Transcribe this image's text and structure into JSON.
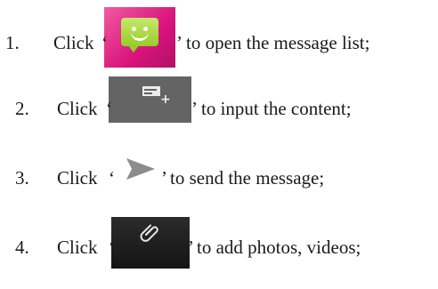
{
  "steps": [
    {
      "number": "1.",
      "click_text": "Click",
      "open_quote": "‘",
      "close_quote": "’",
      "rest": "to open the message list;",
      "icon": "messaging-app-icon",
      "icon_colors": {
        "background": "#d8147c",
        "bubble": "#97cc2c"
      }
    },
    {
      "number": "2.",
      "click_text": "Click",
      "open_quote": "‘",
      "close_quote": "’",
      "rest": "to input the content;",
      "icon": "new-message-icon",
      "icon_colors": {
        "background": "#646464",
        "glyph": "#ececec"
      }
    },
    {
      "number": "3.",
      "click_text": "Click",
      "open_quote": "‘",
      "close_quote": "’",
      "rest": "to send the message;",
      "icon": "send-arrow-icon",
      "icon_colors": {
        "glyph": "#8c8c8c"
      }
    },
    {
      "number": "4.",
      "click_text": "Click",
      "open_quote": "‘",
      "close_quote": "’",
      "rest": "to add photos, videos;",
      "icon": "paperclip-attach-icon",
      "icon_colors": {
        "background": "#1f1f1f",
        "glyph": "#e6e6e6"
      }
    }
  ]
}
